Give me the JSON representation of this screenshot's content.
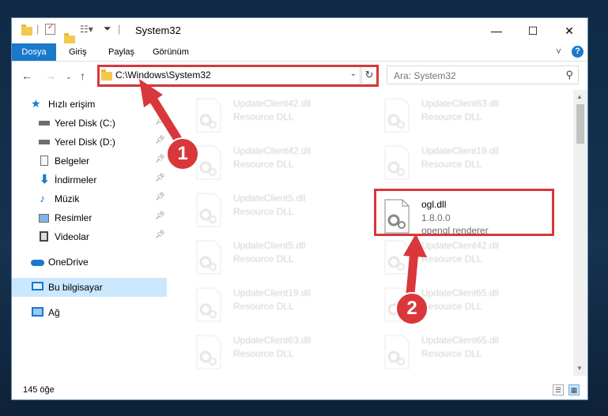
{
  "window": {
    "title": "System32",
    "minimize_glyph": "—",
    "maximize_glyph": "☐",
    "close_glyph": "✕"
  },
  "ribbon": {
    "tabs": [
      "Dosya",
      "Giriş",
      "Paylaş",
      "Görünüm"
    ],
    "collapse_glyph": "˅",
    "help_glyph": "?"
  },
  "address": {
    "path": "C:\\Windows\\System32",
    "refresh_glyph": "↻"
  },
  "search": {
    "placeholder": "Ara: System32"
  },
  "nav": {
    "quick_access": "Hızlı erişim",
    "items": [
      {
        "label": "Yerel Disk (C:)",
        "icon": "drive-icon"
      },
      {
        "label": "Yerel Disk (D:)",
        "icon": "drive-icon"
      },
      {
        "label": "Belgeler",
        "icon": "documents-icon"
      },
      {
        "label": "İndirmeler",
        "icon": "downloads-icon"
      },
      {
        "label": "Müzik",
        "icon": "music-icon"
      },
      {
        "label": "Resimler",
        "icon": "pictures-icon"
      },
      {
        "label": "Videolar",
        "icon": "videos-icon"
      }
    ],
    "onedrive": "OneDrive",
    "this_pc": "Bu bilgisayar",
    "network": "Ağ"
  },
  "files": {
    "active": {
      "name": "ogl.dll",
      "version": "1.8.0.0",
      "description": "opengl renderer"
    },
    "background": [
      {
        "name": "UpdateClient42.dll",
        "type": "Resource DLL"
      },
      {
        "name": "UpdateClient63.dll",
        "type": "Resource DLL"
      },
      {
        "name": "UpdateClient42.dll",
        "type": "Resource DLL"
      },
      {
        "name": "UpdateClient19.dll",
        "type": "Resource DLL"
      },
      {
        "name": "UpdateClient5.dll",
        "type": "Resource DLL"
      },
      {
        "name": "UpdateClient5.dll",
        "type": "Resource DLL"
      },
      {
        "name": "UpdateClient42.dll",
        "type": "Resource DLL"
      },
      {
        "name": "UpdateClient19.dll",
        "type": "Resource DLL"
      },
      {
        "name": "UpdateClient65.dll",
        "type": "Resource DLL"
      },
      {
        "name": "UpdateClient63.dll",
        "type": "Resource DLL"
      },
      {
        "name": "UpdateClient65.dll",
        "type": "Resource DLL"
      }
    ]
  },
  "status": {
    "item_count": "145 öğe"
  },
  "annotations": {
    "step1": "1",
    "step2": "2",
    "color": "#d9373b"
  }
}
